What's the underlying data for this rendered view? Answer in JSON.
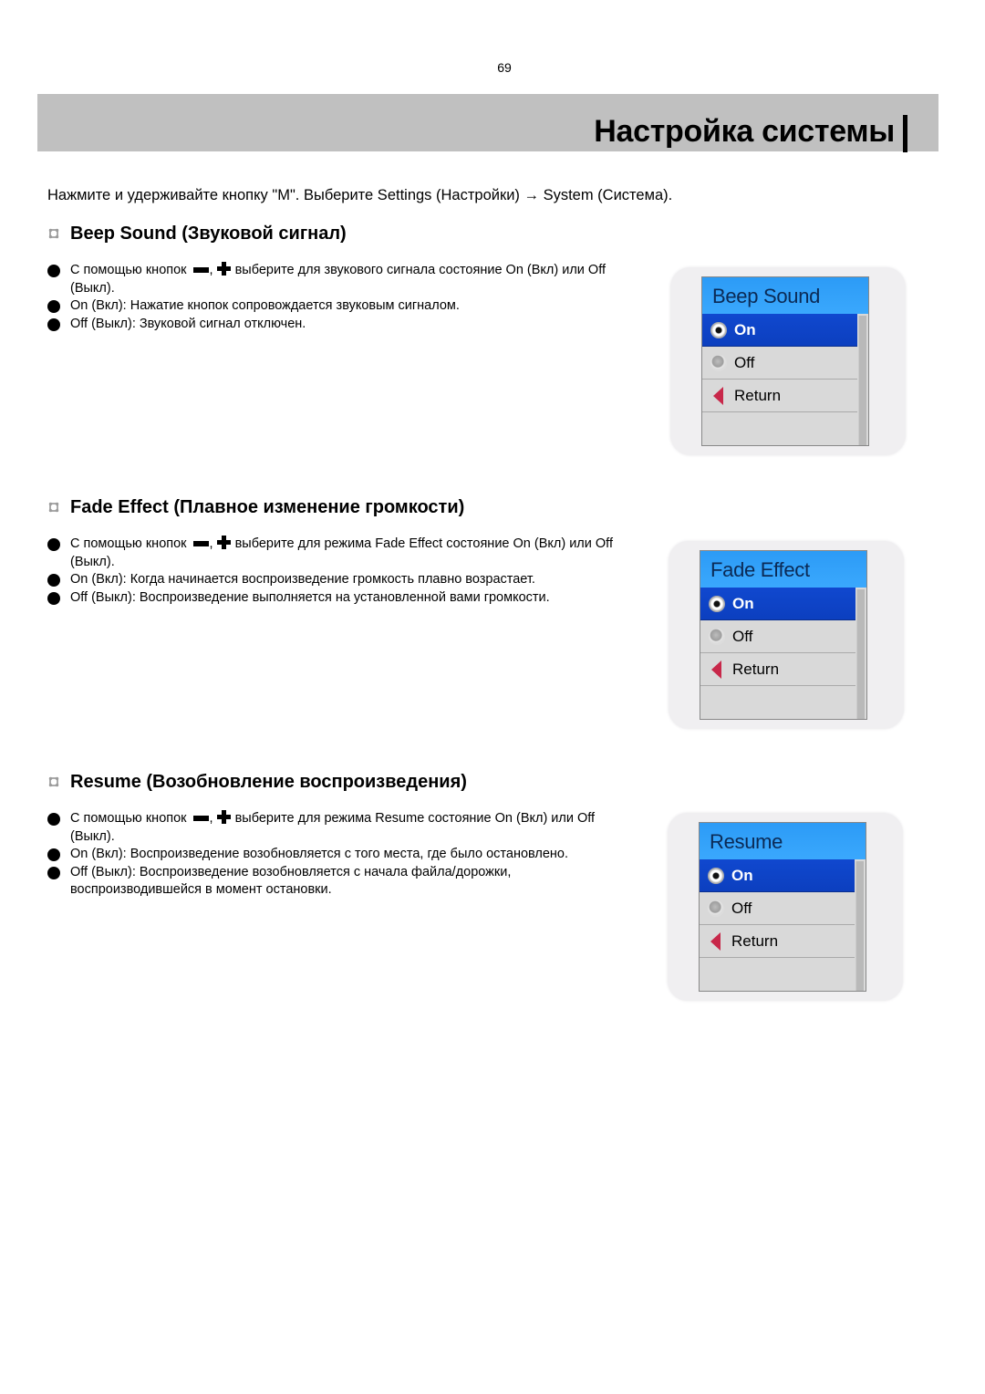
{
  "page": {
    "number": "69",
    "title": "Настройка системы",
    "intro": "Нажмите и удерживайте кнопку \"M\". Выберите Settings (Настройки) → System (Система)."
  },
  "sections": [
    {
      "heading": "Beep Sound (Звуковой сигнал)",
      "bullets": [
        {
          "before": "С помощью кнопок",
          "after": "выберите для звукового сигнала состояние On (Вкл) или Off (Выкл).",
          "has_buttons": true
        },
        {
          "text": "On (Вкл): Нажатие кнопок сопровождается звуковым сигналом."
        },
        {
          "text": "Off (Выкл): Звуковой сигнал отключен."
        }
      ],
      "screen": {
        "title": "Beep Sound",
        "options": [
          {
            "label": "On",
            "icon": "radio-selected-icon",
            "selected": true
          },
          {
            "label": "Off",
            "icon": "radio-unselected-icon",
            "selected": false
          },
          {
            "label": "Return",
            "icon": "return-arrow-icon",
            "selected": false
          }
        ]
      }
    },
    {
      "heading": "Fade Effect (Плавное изменение громкости)",
      "bullets": [
        {
          "before": "С помощью кнопок",
          "after": "выберите для режима Fade Effect состояние On (Вкл) или Off (Выкл).",
          "has_buttons": true
        },
        {
          "text": "On (Вкл): Когда начинается воспроизведение громкость плавно возрастает."
        },
        {
          "text": "Off (Выкл): Воспроизведение выполняется на установленной вами громкости."
        }
      ],
      "screen": {
        "title": "Fade Effect",
        "options": [
          {
            "label": "On",
            "icon": "radio-selected-icon",
            "selected": true
          },
          {
            "label": "Off",
            "icon": "radio-unselected-icon",
            "selected": false
          },
          {
            "label": "Return",
            "icon": "return-arrow-icon",
            "selected": false
          }
        ]
      }
    },
    {
      "heading": "Resume (Возобновление воспроизведения)",
      "bullets": [
        {
          "before": "С помощью кнопок",
          "after": "выберите для режима Resume состояние On (Вкл) или Off (Выкл).",
          "has_buttons": true
        },
        {
          "text": "On (Вкл): Воспроизведение возобновляется с того места, где было остановлено."
        },
        {
          "text": "Off (Выкл): Воспроизведение возобновляется с начала файла/дорожки, воспроизводившейся в момент остановки."
        }
      ],
      "screen": {
        "title": "Resume",
        "options": [
          {
            "label": "On",
            "icon": "radio-selected-icon",
            "selected": true
          },
          {
            "label": "Off",
            "icon": "radio-unselected-icon",
            "selected": false
          },
          {
            "label": "Return",
            "icon": "return-arrow-icon",
            "selected": false
          }
        ]
      }
    }
  ],
  "icons": {
    "section_marker": "section-marker-icon",
    "minus_button": "minus-button-icon",
    "plus_button": "plus-button-icon",
    "comma": ","
  },
  "colors": {
    "title_bar": "#c0c0c0",
    "screen_header": "#2c9bf6",
    "screen_selected": "#1048cf",
    "return_arrow": "#c8284a"
  }
}
